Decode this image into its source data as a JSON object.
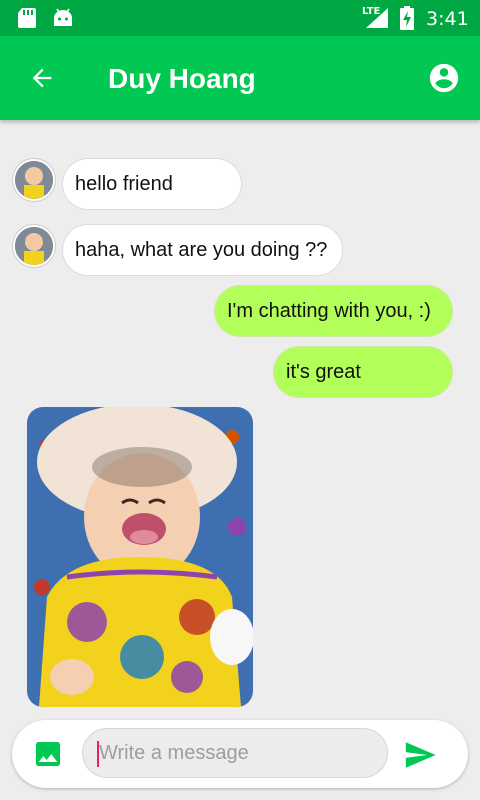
{
  "status_bar": {
    "network_label": "LTE",
    "time": "3:41",
    "icons": [
      "sd-card-icon",
      "android-icon",
      "signal-icon",
      "battery-charging-icon"
    ]
  },
  "app_bar": {
    "title": "Duy Hoang",
    "icons": [
      "arrow-back-icon",
      "account-circle-icon"
    ]
  },
  "messages": [
    {
      "direction": "in",
      "text": "hello friend"
    },
    {
      "direction": "in",
      "text": "haha, what are you doing ??"
    },
    {
      "direction": "out",
      "text": "I'm chatting with you, :)"
    },
    {
      "direction": "out",
      "text": "it's great"
    },
    {
      "direction": "in",
      "type": "image"
    }
  ],
  "composer": {
    "placeholder": "Write a message",
    "icons": [
      "image-icon",
      "send-icon"
    ]
  },
  "colors": {
    "status_bar": "#00a844",
    "app_bar": "#00c853",
    "outgoing_bubble": "#b2ff59",
    "incoming_bubble": "#ffffff",
    "background": "#ededed",
    "accent": "#00c853"
  }
}
